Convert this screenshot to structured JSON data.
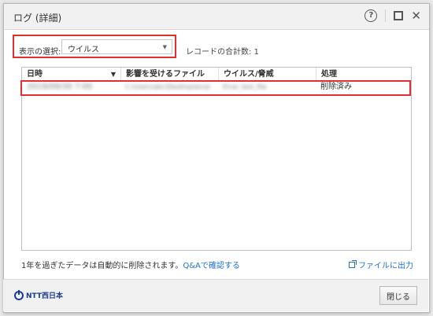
{
  "window": {
    "title": "ログ (詳細)",
    "help_icon": "?",
    "maximize_icon": "maximize-icon",
    "close_icon": "✕"
  },
  "filter": {
    "label": "表示の選択:",
    "selected": "ウイルス",
    "record_count_label": "レコードの合計数: 1"
  },
  "table": {
    "columns": [
      "日時",
      "影響を受けるファイル",
      "ウイルス/脅威",
      "処理"
    ],
    "sort_icon": "▼",
    "rows": [
      {
        "datetime": "2019/09/30 7:00",
        "file": "C:\\Users\\abc\\Desktop\\eicar",
        "threat": "Eicar_test_file",
        "action": "削除済み"
      }
    ]
  },
  "footer_note": {
    "text": "1年を過ぎたデータは自動的に削除されます。",
    "link": "Q&Aで確認する"
  },
  "export_label": "ファイルに出力",
  "brand": "NTT西日本",
  "close_button": "閉じる",
  "colors": {
    "highlight": "#e03030",
    "link": "#1e6fd0",
    "brand": "#1b3c8f"
  }
}
